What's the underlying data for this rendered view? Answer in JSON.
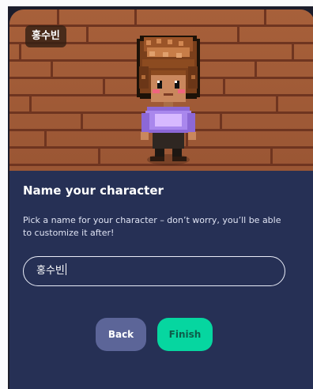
{
  "character": {
    "name_tag": "홍수빈"
  },
  "dialog": {
    "title": "Name your character",
    "description": "Pick a name for your character – don’t worry, you’ll be able to customize it after!"
  },
  "name_input": {
    "value": "홍수빈"
  },
  "actions": {
    "back_label": "Back",
    "finish_label": "Finish"
  },
  "colors": {
    "panel": "#263055",
    "floor": "#a7603a",
    "back_button": "#5c6598",
    "finish_button": "#06d6a0"
  }
}
